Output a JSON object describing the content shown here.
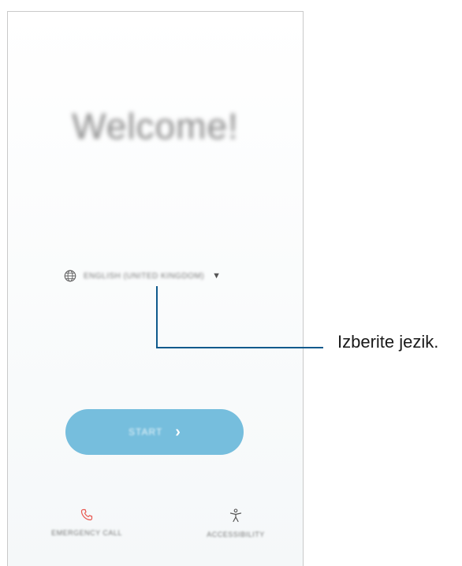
{
  "screen": {
    "welcome_title": "Welcome!",
    "language_selector": {
      "value": "ENGLISH (UNITED KINGDOM)",
      "icon": "globe-icon",
      "dropdown_glyph": "▼"
    },
    "start_button": {
      "label": "START",
      "chevron": "›"
    },
    "bottom": {
      "emergency_call": {
        "label": "EMERGENCY CALL",
        "icon": "phone-icon",
        "icon_color": "#e8574f"
      },
      "accessibility": {
        "label": "ACCESSIBILITY",
        "icon": "accessibility-icon"
      }
    },
    "colors": {
      "start_button": "#76bedd",
      "leader_line": "#0f5a8c"
    }
  },
  "annotation": {
    "callout_text": "Izberite jezik."
  }
}
